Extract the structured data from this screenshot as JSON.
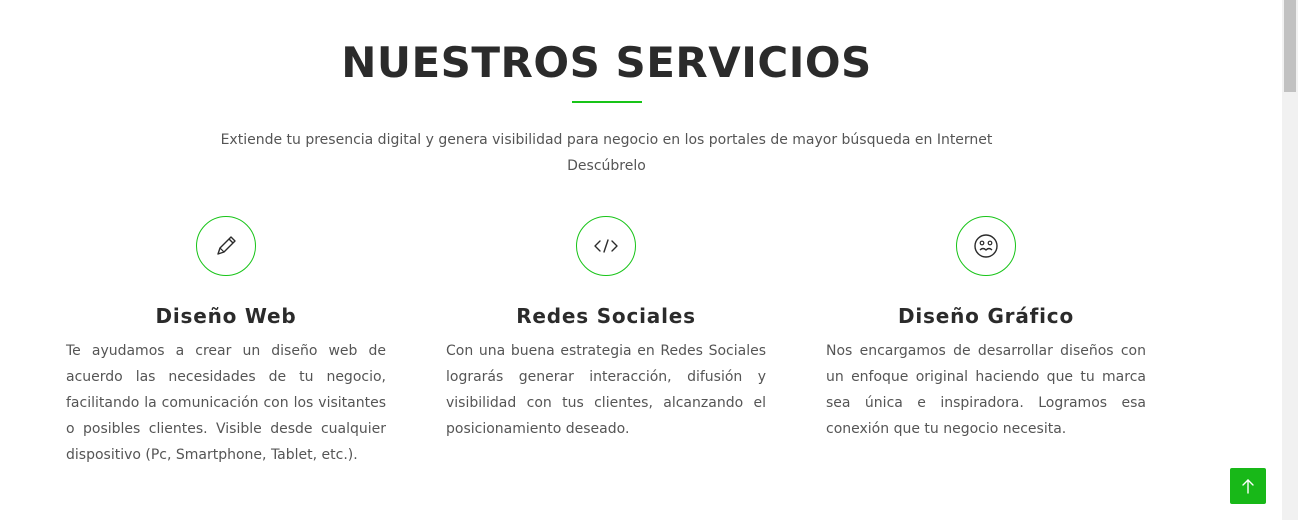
{
  "section": {
    "title": "NUESTROS SERVICIOS",
    "subtitle_line1": "Extiende tu presencia digital y genera visibilidad para negocio en los portales de mayor búsqueda en Internet",
    "subtitle_line2": "Descúbrelo",
    "accent_color": "#18c418"
  },
  "services": [
    {
      "icon": "pencil-icon",
      "title": "Diseño Web",
      "text": "Te ayudamos a crear un diseño web de acuerdo las necesidades de tu negocio, facilitando la comunicación con los visitantes o posibles clientes. Visible desde cualquier dispositivo (Pc, Smartphone, Tablet, etc.)."
    },
    {
      "icon": "code-icon",
      "title": "Redes Sociales",
      "text": "Con una buena estrategia en Redes Sociales lograrás generar interacción, difusión y visibilidad con tus clientes, alcanzando el posicionamiento deseado."
    },
    {
      "icon": "smiley-icon",
      "title": "Diseño Gráfico",
      "text": "Nos encargamos de desarrollar diseños con un enfoque original haciendo que tu marca sea única e inspiradora. Logramos esa conexión que tu negocio necesita."
    }
  ],
  "scroll_top": {
    "icon": "arrow-up-icon",
    "color": "#18b818"
  }
}
